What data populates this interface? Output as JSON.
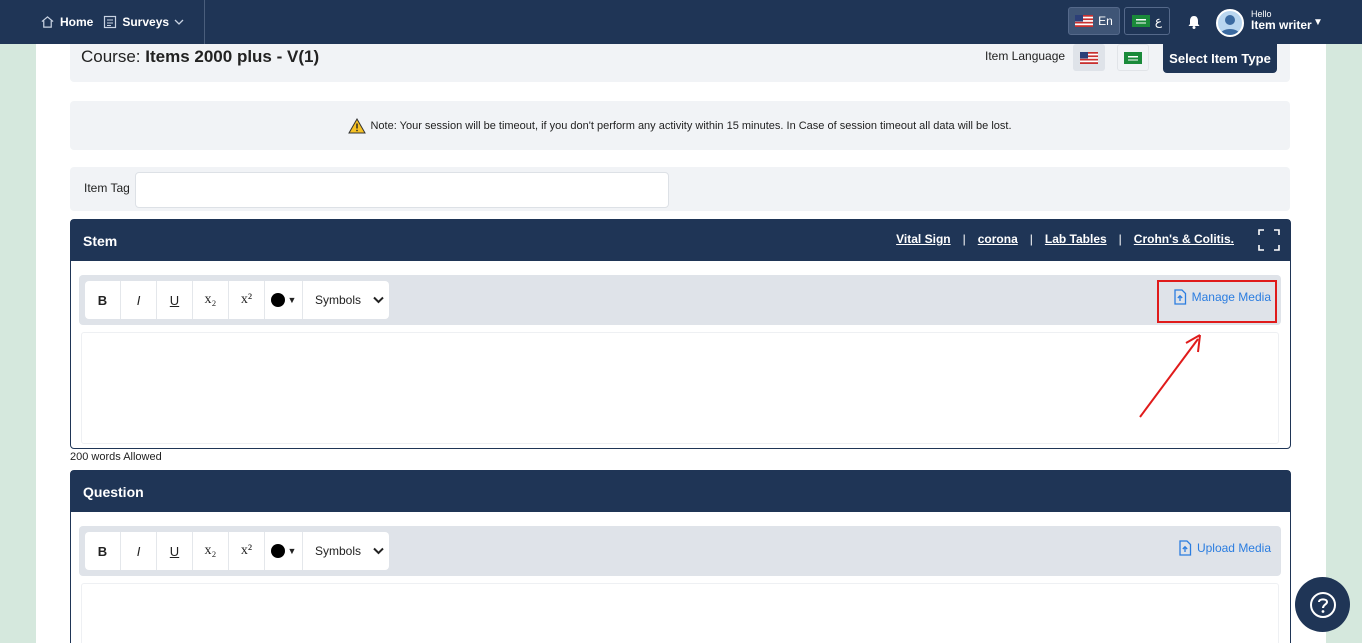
{
  "nav": {
    "home_label": "Home",
    "surveys_label": "Surveys"
  },
  "language_switch": {
    "english_label": "En",
    "arabic_label": "ع"
  },
  "user": {
    "greeting": "Hello",
    "name": "Item writer"
  },
  "course": {
    "prefix": "Course:",
    "name": "Items 2000 plus - V(1)",
    "item_language_label": "Item Language",
    "select_item_type_label": "Select Item Type"
  },
  "note": {
    "text": "Note: Your session will be timeout, if you don't perform any activity within 15 minutes. In Case of session timeout all data will be lost."
  },
  "item_tag": {
    "label": "Item Tag",
    "value": ""
  },
  "stem": {
    "title": "Stem",
    "links": [
      "Vital Sign",
      "corona",
      "Lab Tables",
      "Crohn's & Colitis."
    ],
    "media_label": "Manage Media",
    "words_allowed": "200 words Allowed"
  },
  "question": {
    "title": "Question",
    "media_label": "Upload Media"
  },
  "toolbar": {
    "bold": "B",
    "italic": "I",
    "underline": "U",
    "subscript": "x₂",
    "superscript": "x²",
    "symbols": "Symbols"
  },
  "colors": {
    "navy": "#1f3556",
    "accent_blue": "#2b7de0",
    "highlight_red": "#e01b1b",
    "page_bg": "#d5e8dd"
  }
}
